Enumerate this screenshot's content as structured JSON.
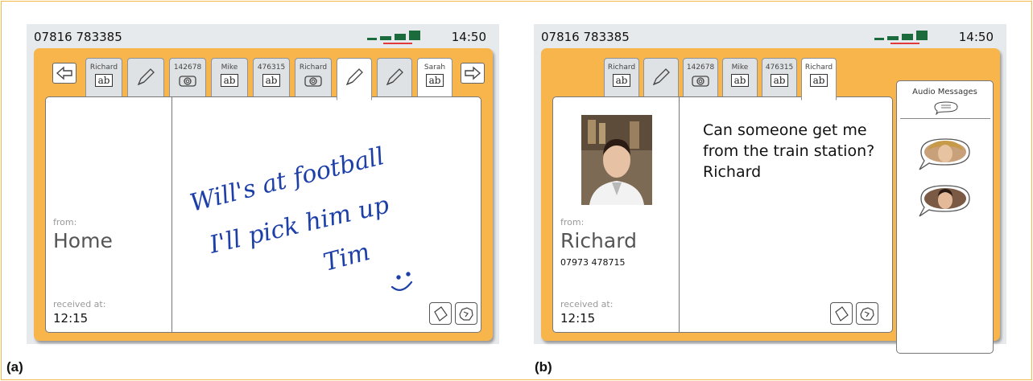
{
  "panel_a": {
    "caption": "(a)",
    "status": {
      "phone_number": "07816 783385",
      "time": "14:50"
    },
    "tabs": [
      {
        "label": "Richard",
        "type": "text",
        "icon": "ab"
      },
      {
        "label": "",
        "type": "drawing",
        "icon": "pen-icon"
      },
      {
        "label": "142678",
        "type": "photo",
        "icon": "camera-icon"
      },
      {
        "label": "Mike",
        "type": "text",
        "icon": "ab"
      },
      {
        "label": "476315",
        "type": "text",
        "icon": "ab"
      },
      {
        "label": "Richard",
        "type": "photo",
        "icon": "camera-icon"
      },
      {
        "label": "",
        "type": "drawing",
        "icon": "pen-icon"
      },
      {
        "label": "",
        "type": "drawing",
        "icon": "pen-icon"
      },
      {
        "label": "Sarah",
        "type": "text",
        "icon": "ab"
      }
    ],
    "message": {
      "from_label": "from:",
      "from_name": "Home",
      "received_label": "received at:",
      "received_time": "12:15",
      "handwriting": [
        "Will's at football",
        "I'll pick him up",
        "Tim"
      ]
    }
  },
  "panel_b": {
    "caption": "(b)",
    "status": {
      "phone_number": "07816 783385",
      "time": "14:50"
    },
    "tabs": [
      {
        "label": "Richard",
        "type": "text",
        "icon": "ab"
      },
      {
        "label": "",
        "type": "drawing",
        "icon": "pen-icon"
      },
      {
        "label": "142678",
        "type": "photo",
        "icon": "camera-icon"
      },
      {
        "label": "Mike",
        "type": "text",
        "icon": "ab"
      },
      {
        "label": "476315",
        "type": "text",
        "icon": "ab"
      },
      {
        "label": "Richard",
        "type": "text",
        "icon": "ab"
      }
    ],
    "message": {
      "from_label": "from:",
      "from_name": "Richard",
      "from_number": "07973 478715",
      "received_label": "received at:",
      "received_time": "12:15",
      "text_lines": [
        "Can someone get me",
        "from the train station?",
        "Richard"
      ]
    },
    "audio": {
      "title": "Audio Messages"
    }
  },
  "colors": {
    "accent": "#f7b54c",
    "signal": "#1b6b3d",
    "ink": "#1d3fa8"
  },
  "tab_text_icon": "ab"
}
